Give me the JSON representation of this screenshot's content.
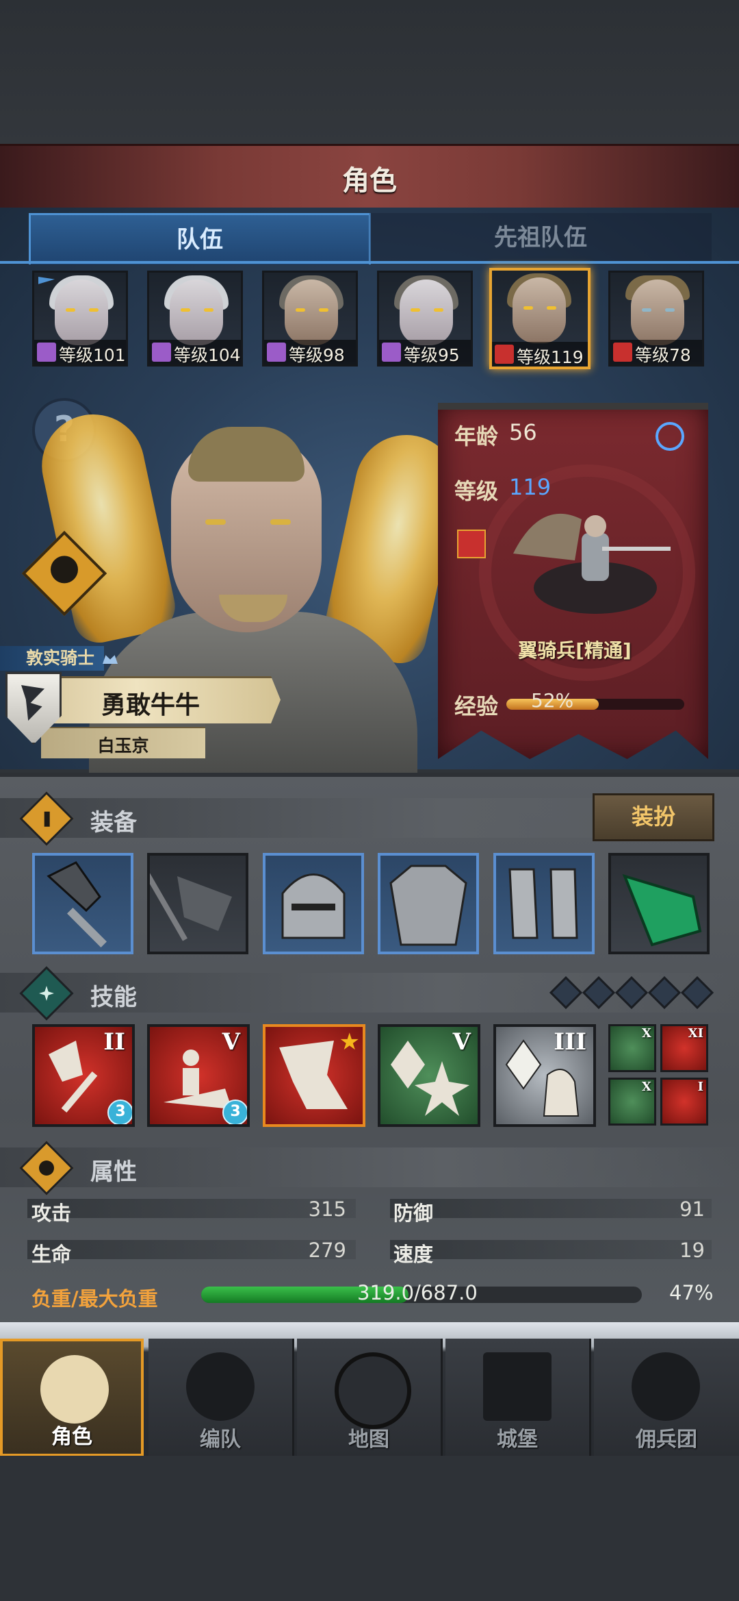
{
  "header": {
    "title": "角色"
  },
  "tabs": {
    "team": "队伍",
    "ancestor": "先祖队伍"
  },
  "roster": [
    {
      "level": "等级101",
      "class": "mage",
      "icon": "staff-icon"
    },
    {
      "level": "等级104",
      "class": "mage",
      "icon": "staff-icon"
    },
    {
      "level": "等级98",
      "class": "mage",
      "icon": "staff-icon"
    },
    {
      "level": "等级95",
      "class": "mage",
      "icon": "staff-icon"
    },
    {
      "level": "等级119",
      "class": "cavalry",
      "icon": "horse-icon"
    },
    {
      "level": "等级78",
      "class": "cavalry",
      "icon": "horse-icon"
    }
  ],
  "hero": {
    "rank": "敦实骑士",
    "name": "勇敢牛牛",
    "city": "白玉京",
    "help": "?"
  },
  "stats_card": {
    "age_label": "年龄",
    "age": "56",
    "level_label": "等级",
    "level": "119",
    "unit": "翼骑兵[精通]",
    "exp_label": "经验",
    "exp": "52%",
    "exp_fraction": 0.52
  },
  "equipment": {
    "title": "装备",
    "dress_button": "装扮"
  },
  "skills": {
    "title": "技能",
    "items": [
      {
        "rank": "II",
        "gem": "3"
      },
      {
        "rank": "V",
        "gem": "3"
      },
      {
        "rank": ""
      },
      {
        "rank": "V"
      },
      {
        "rank": "III"
      }
    ],
    "minis": [
      "X",
      "XI",
      "X",
      "I"
    ]
  },
  "attributes": {
    "title": "属性",
    "attack_label": "攻击",
    "attack": "315",
    "defense_label": "防御",
    "defense": "91",
    "hp_label": "生命",
    "hp": "279",
    "speed_label": "速度",
    "speed": "19",
    "load_label": "负重/最大负重",
    "load": "319.0/687.0",
    "load_pct": "47%",
    "load_fraction": 0.47
  },
  "nav": [
    {
      "label": "角色",
      "icon": "knight-icon"
    },
    {
      "label": "编队",
      "icon": "helmet-icon"
    },
    {
      "label": "地图",
      "icon": "compass-icon"
    },
    {
      "label": "城堡",
      "icon": "castle-icon"
    },
    {
      "label": "佣兵团",
      "icon": "fist-banner-icon"
    }
  ],
  "colors": {
    "accent_gold": "#e8a532",
    "tab_blue": "#4f93d4",
    "level_blue": "#5aa7ff",
    "load_orange": "#f2a23c"
  }
}
